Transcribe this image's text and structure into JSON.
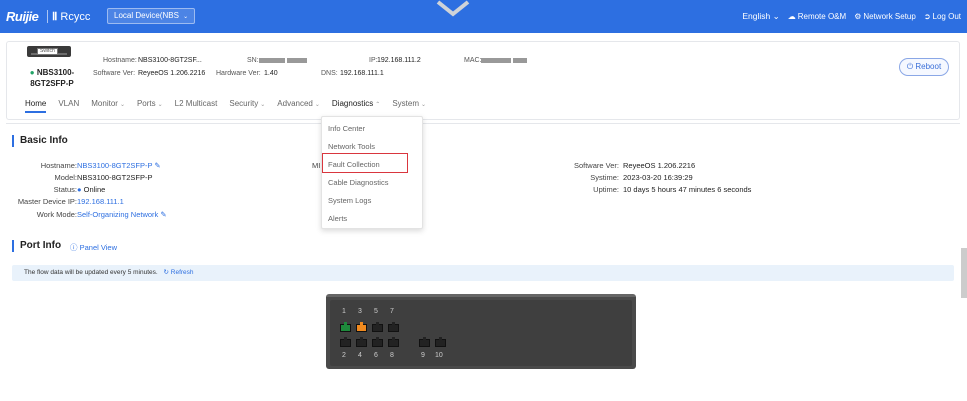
{
  "topbar": {
    "brand": "Ruijie",
    "brand2_b": "Ⅱ",
    "brand2": "Rcycc",
    "device_select": "Local Device(NBS",
    "language": "English",
    "remote_om": "Remote O&M",
    "network_setup": "Network Setup",
    "logout": "Log Out"
  },
  "device": {
    "switch_label": "Switch",
    "name_line1": "NBS3100-",
    "name_line2": "8GT2SFP-P",
    "hostname_label": "Hostname:",
    "hostname": "NBS3100-8GT2SF...",
    "sw_label": "Software Ver:",
    "sw": "ReyeeOS 1.206.2216",
    "sn_label": "SN:",
    "hw_label": "Hardware Ver:",
    "hw": "1.40",
    "ip_label": "IP:",
    "ip": "192.168.111.2",
    "dns_label": "DNS:",
    "dns": "192.168.111.1",
    "mac_label": "MAC:",
    "reboot": "Reboot"
  },
  "nav": {
    "tabs": [
      "Home",
      "VLAN",
      "Monitor",
      "Ports",
      "L2 Multicast",
      "Security",
      "Advanced",
      "Diagnostics",
      "System"
    ]
  },
  "dropdown": {
    "items": [
      "Info Center",
      "Network Tools",
      "Fault Collection",
      "Cable Diagnostics",
      "System Logs",
      "Alerts"
    ]
  },
  "basic_info": {
    "title": "Basic Info",
    "hostname_label": "Hostname:",
    "hostname": "NBS3100-8GT2SFP-P",
    "model_label": "Model:",
    "model": "NBS3100-8GT2SFP-P",
    "status_label": "Status:",
    "status": "Online",
    "master_label": "Master Device IP:",
    "master": "192.168.111.1",
    "workmode_label": "Work Mode:",
    "workmode": "Self-Organizing Network",
    "mi_label": "MI",
    "software_label": "Software Ver:",
    "software": "ReyeeOS 1.206.2216",
    "systime_label": "Systime:",
    "systime": "2023-03-20 16:39:29",
    "uptime_label": "Uptime:",
    "uptime": "10 days 5 hours 47 minutes 6 seconds"
  },
  "port_info": {
    "title": "Port Info",
    "panel_view": "Panel View",
    "notice": "The flow data will be updated every 5 minutes.",
    "refresh": "Refresh",
    "top_numbers": [
      "1",
      "3",
      "5",
      "7"
    ],
    "bottom_numbers": [
      "2",
      "4",
      "6",
      "8",
      "9",
      "10"
    ]
  }
}
